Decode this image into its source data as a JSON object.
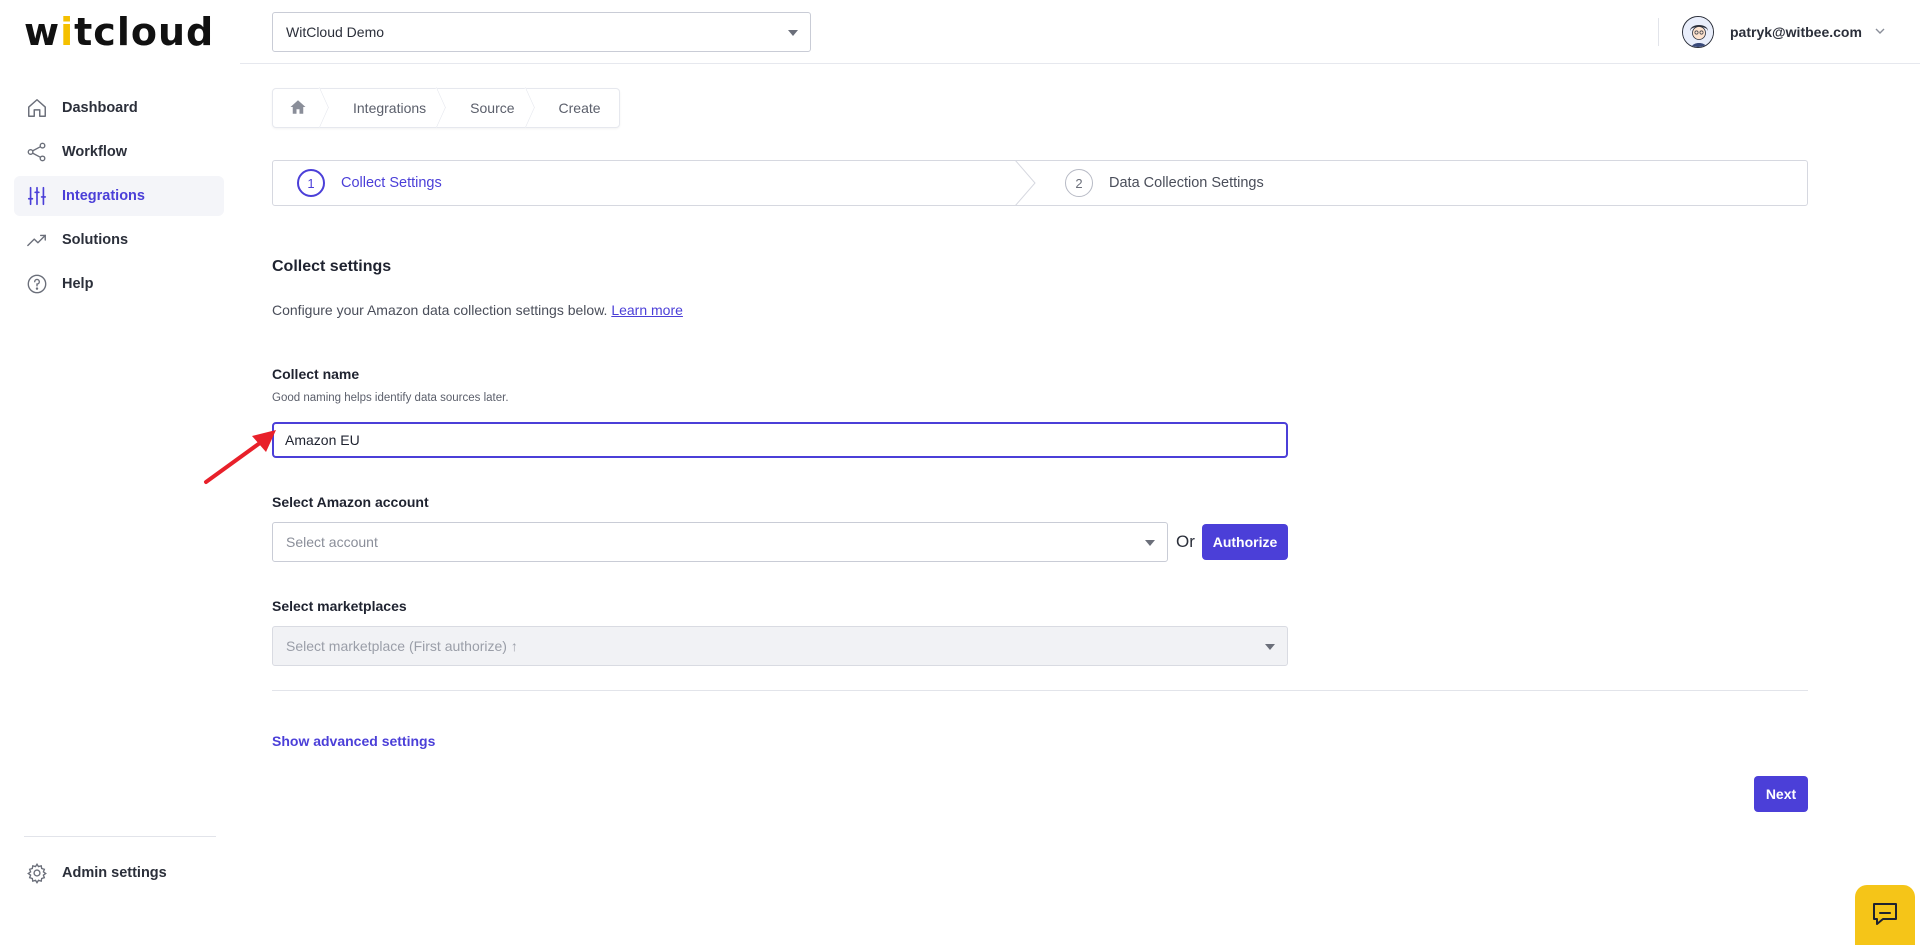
{
  "brand": {
    "logo_prefix": "w",
    "logo_accent": "i",
    "logo_suffix": "tcloud"
  },
  "sidebar": {
    "items": [
      {
        "label": "Dashboard",
        "icon": "home-icon",
        "active": false
      },
      {
        "label": "Workflow",
        "icon": "share-nodes-icon",
        "active": false
      },
      {
        "label": "Integrations",
        "icon": "sliders-icon",
        "active": true
      },
      {
        "label": "Solutions",
        "icon": "trending-up-icon",
        "active": false
      },
      {
        "label": "Help",
        "icon": "question-circle-icon",
        "active": false
      }
    ],
    "admin_label": "Admin settings"
  },
  "topbar": {
    "org_selected": "WitCloud Demo",
    "user_email": "patryk@witbee.com"
  },
  "breadcrumb": [
    "Integrations",
    "Source",
    "Create"
  ],
  "stepper": {
    "steps": [
      {
        "number": "1",
        "label": "Collect Settings",
        "active": true
      },
      {
        "number": "2",
        "label": "Data Collection Settings",
        "active": false
      }
    ]
  },
  "form": {
    "title": "Collect settings",
    "description": "Configure your Amazon data collection settings below.",
    "learn_more": "Learn more",
    "collect_name": {
      "label": "Collect name",
      "help": "Good naming helps identify data sources later.",
      "value": "Amazon EU"
    },
    "account": {
      "label": "Select Amazon account",
      "placeholder": "Select account",
      "or_text": "Or",
      "authorize_label": "Authorize"
    },
    "marketplaces": {
      "label": "Select marketplaces",
      "placeholder": "Select marketplace (First authorize) ↑"
    },
    "advanced_link": "Show advanced settings",
    "next_label": "Next"
  },
  "colors": {
    "accent": "#4b3fd8",
    "logo_accent": "#f5c000",
    "chat": "#f5c518",
    "annotation_arrow": "#e8202a"
  }
}
